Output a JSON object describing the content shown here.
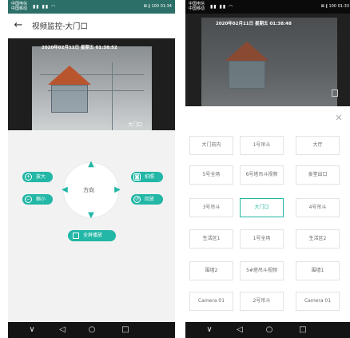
{
  "left": {
    "status": {
      "carrier1": "中国电信",
      "carrier2": "中国移动",
      "right": "⊠ ∦ 100 01:34"
    },
    "header": {
      "back_icon": "arrow-left-icon",
      "title": "视频监控-大门口"
    },
    "video": {
      "timestamp": "2020年02月11日  星期五  01:38:52",
      "camera_label": "大门口"
    },
    "controls": {
      "zoom_in": "放大",
      "zoom_out": "缩小",
      "capture": "拍照",
      "playback": "回放",
      "direction_label": "方向",
      "fullscreen": "全屏播放"
    },
    "nav": {
      "menu": "∨",
      "back": "◁",
      "home": "○",
      "recent": "□"
    }
  },
  "right": {
    "status": {
      "carrier1": "中国电信",
      "carrier2": "中国移动",
      "right": "⊠ ∦ 100 01:33"
    },
    "video": {
      "timestamp": "2020年02月11日  星期五  01:38:48"
    },
    "close": "✕",
    "cameras": [
      "大门前内",
      "1号吊斗",
      "大厅",
      "5号全场",
      "6号塔吊斗视频",
      "食堂出口",
      "3号吊斗",
      "大门口",
      "4号吊斗",
      "生活区1",
      "1号全场",
      "生活区2",
      "围墙2",
      "5#塔吊斗视频",
      "围墙1",
      "Camera 01",
      "2号吊斗",
      "Camera 01"
    ],
    "selected_camera": "大门口",
    "nav": {
      "menu": "∨",
      "back": "◁",
      "home": "○",
      "recent": "□"
    }
  },
  "colors": {
    "accent": "#22b7a6",
    "status_bar_left": "#2c6f68",
    "status_bar_right": "#0a0a0a",
    "nav_bar": "#141414"
  }
}
